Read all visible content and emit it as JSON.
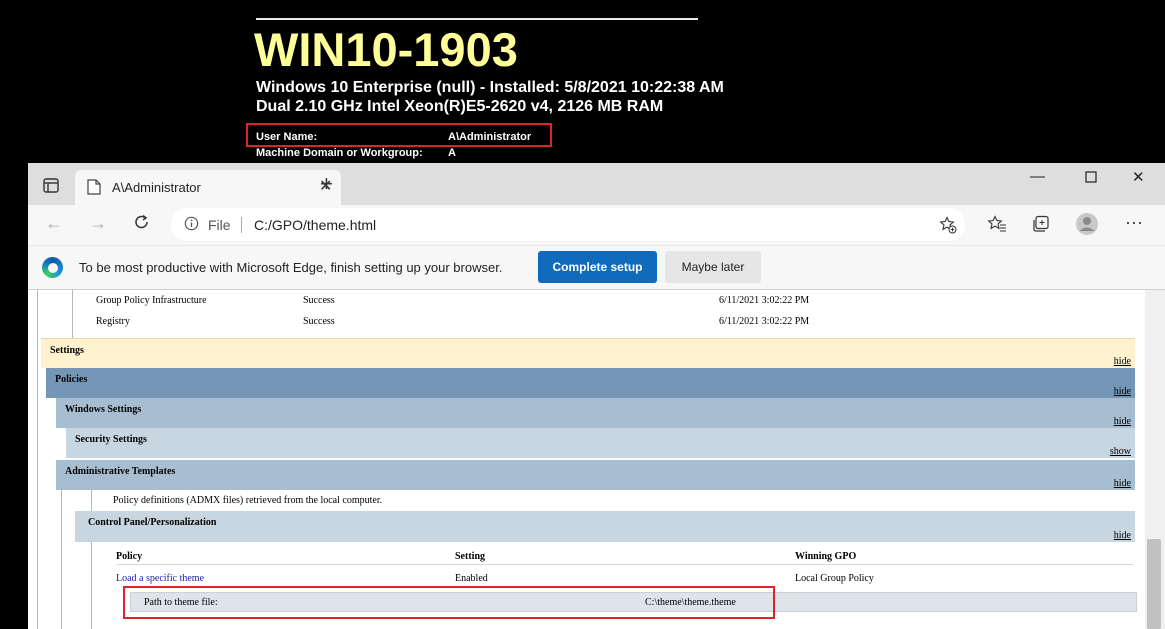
{
  "bginfo": {
    "hostname": "WIN10-1903",
    "os_line": "Windows 10 Enterprise (null) - Installed: 5/8/2021 10:22:38 AM",
    "cpu_line": "Dual 2.10 GHz Intel Xeon(R)E5-2620 v4,  2126 MB RAM",
    "user_label": "User Name:",
    "user_value": "A\\Administrator",
    "domain_label": "Machine Domain or Workgroup:",
    "domain_value": "A"
  },
  "browser": {
    "tab_title": "A\\Administrator",
    "address_scheme": "File",
    "address_url": "C:/GPO/theme.html",
    "infobar_text": "To be most productive with Microsoft Edge, finish setting up your browser.",
    "complete_setup_label": "Complete setup",
    "maybe_later_label": "Maybe later",
    "icons": [
      "tab-actions-icon",
      "page-favicon-icon",
      "close-icon",
      "new-tab-icon",
      "minimize-icon",
      "maximize-icon",
      "window-close-icon",
      "back-icon",
      "forward-icon",
      "refresh-icon",
      "info-icon",
      "add-favorite-icon",
      "favorites-icon",
      "collections-icon",
      "profile-icon",
      "more-icon",
      "edge-logo-icon"
    ]
  },
  "report": {
    "components": [
      {
        "name": "Group Policy Infrastructure",
        "status": "Success",
        "time": "6/11/2021 3:02:22 PM"
      },
      {
        "name": "Registry",
        "status": "Success",
        "time": "6/11/2021 3:02:22 PM"
      }
    ],
    "settings": {
      "title": "Settings",
      "toggle": "hide",
      "color": "#fef2cf"
    },
    "policies": {
      "title": "Policies",
      "toggle": "hide",
      "color": "#7497b7"
    },
    "windows_settings": {
      "title": "Windows Settings",
      "toggle": "hide",
      "color": "#a7bed2"
    },
    "security_settings": {
      "title": "Security Settings",
      "toggle": "show",
      "color": "#c8d6e2"
    },
    "admin_templates": {
      "title": "Administrative Templates",
      "toggle": "hide",
      "color": "#a7bed2"
    },
    "admx_note": "Policy definitions (ADMX files) retrieved from the local computer.",
    "control_panel": {
      "title": "Control Panel/Personalization",
      "toggle": "hide",
      "color": "#c8d6e2"
    },
    "table": {
      "headers": [
        "Policy",
        "Setting",
        "Winning GPO"
      ],
      "row": {
        "policy": "Load a specific theme",
        "setting": "Enabled",
        "gpo": "Local Group Policy"
      },
      "detail": {
        "label": "Path to theme file:",
        "value": "C:\\theme\\theme.theme"
      }
    }
  }
}
